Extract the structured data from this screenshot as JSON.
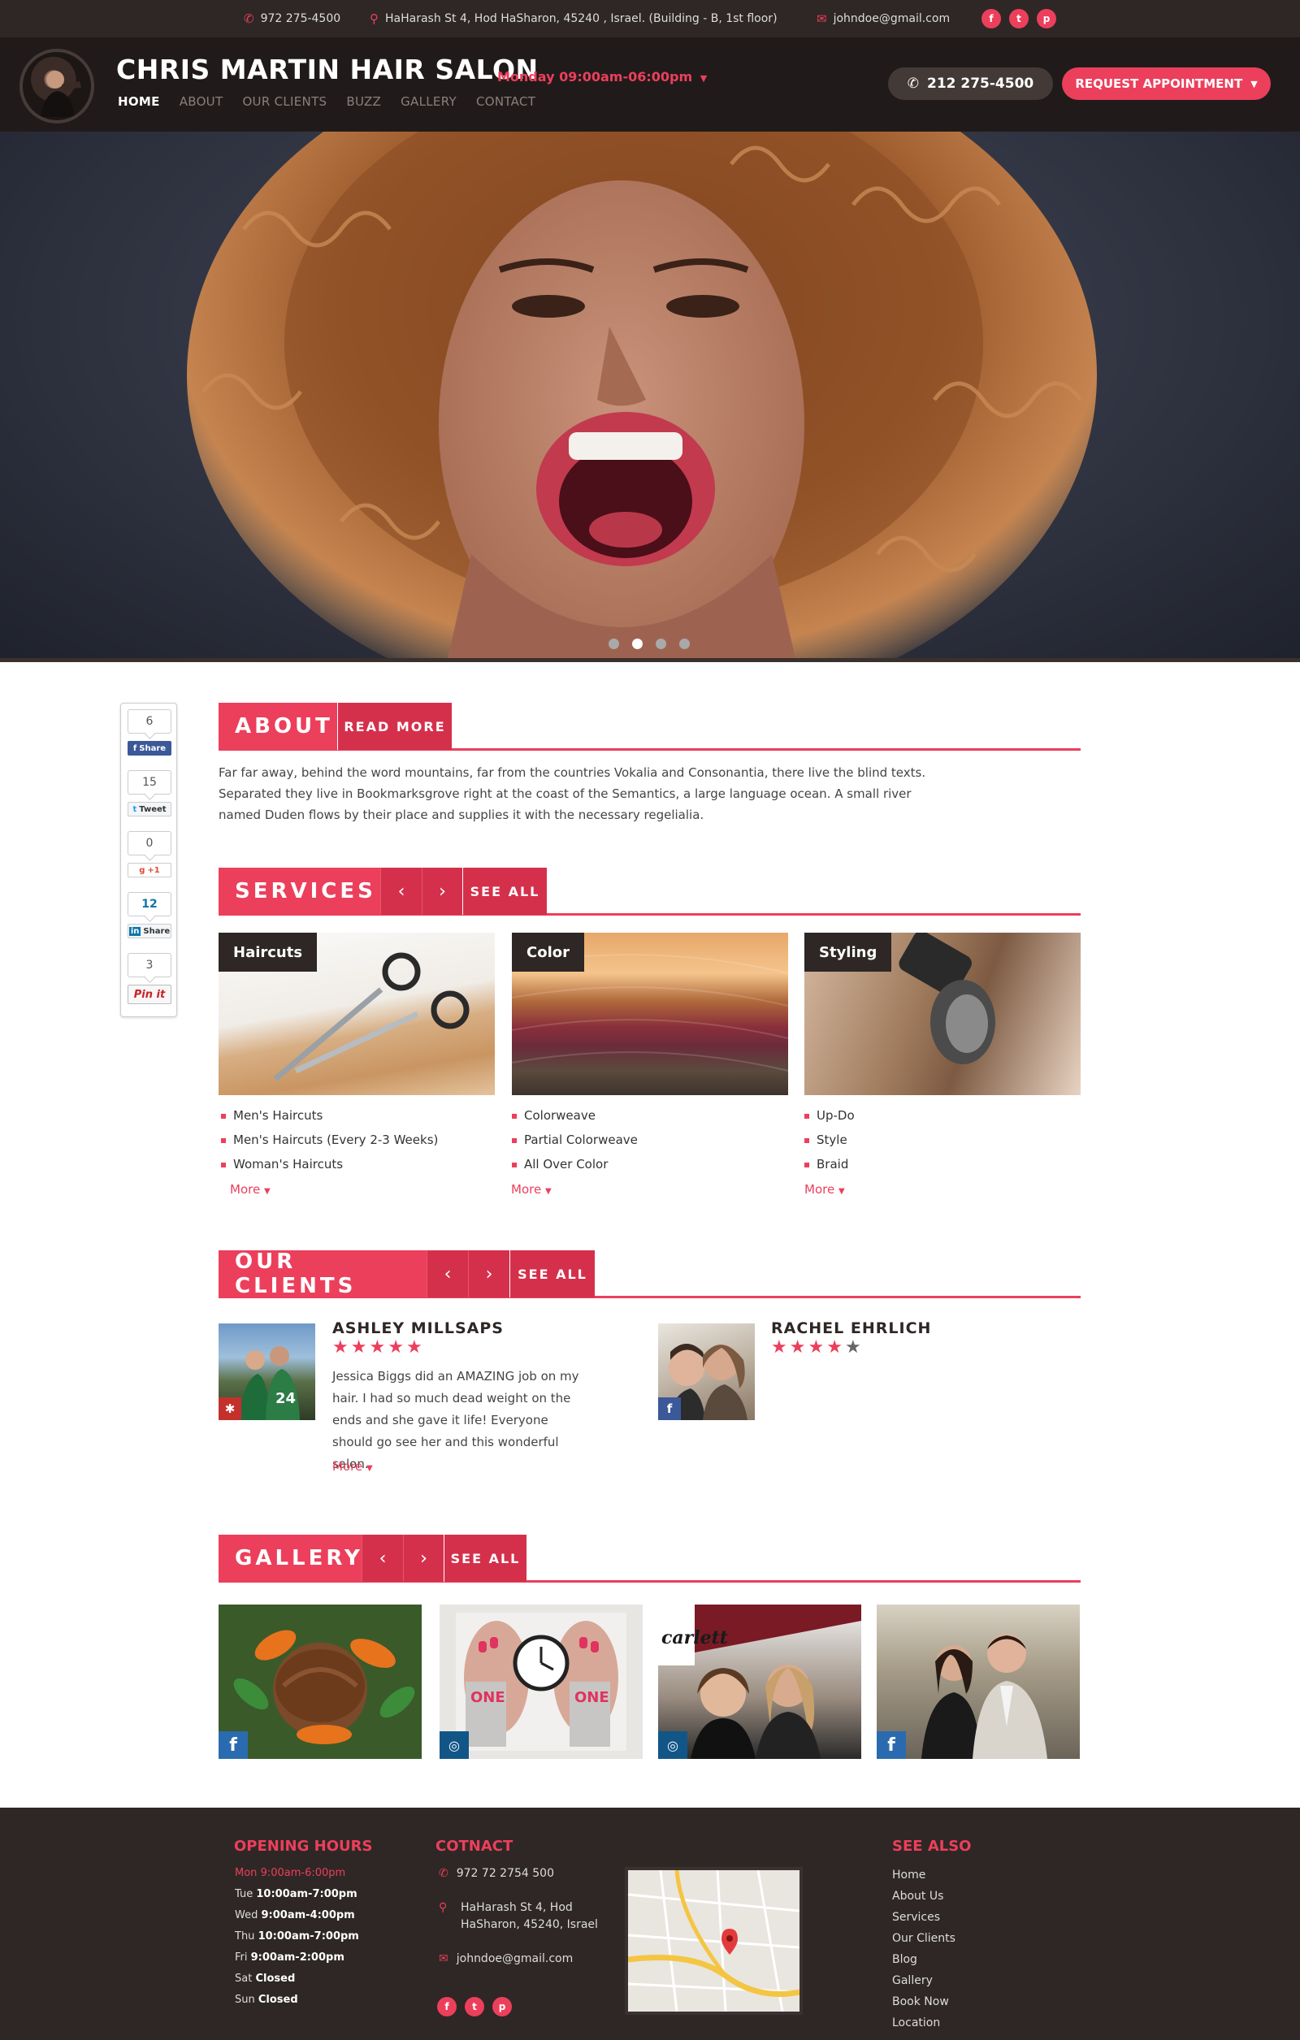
{
  "topbar": {
    "phone": "972 275-4500",
    "address": "HaHarash St 4, Hod HaSharon, 45240 , Israel. (Building - B, 1st floor)",
    "email": "johndoe@gmail.com",
    "social": [
      "facebook-icon",
      "twitter-icon",
      "pinterest-icon"
    ]
  },
  "header": {
    "title": "CHRIS MARTIN HAIR SALON",
    "hours": "Monday 09:00am-06:00pm",
    "nav": [
      "HOME",
      "ABOUT",
      "OUR CLIENTS",
      "BUZZ",
      "GALLERY",
      "CONTACT"
    ],
    "active_nav": "HOME",
    "phone_button": "212 275-4500",
    "appointment_button": "REQUEST APPOINTMENT"
  },
  "hero": {
    "slide_count": 4,
    "active_slide": 2
  },
  "share": {
    "facebook": {
      "count": "6",
      "label": "Share"
    },
    "twitter": {
      "count": "15",
      "label": "Tweet"
    },
    "google": {
      "count": "0",
      "label": "+1"
    },
    "linkedin": {
      "count": "12",
      "label": "Share"
    },
    "pinterest": {
      "count": "3",
      "label": "Pin it"
    }
  },
  "about": {
    "title": "ABOUT",
    "read_more": "READ MORE",
    "text": "Far far away, behind the word mountains, far from the countries Vokalia and Consonantia, there live the blind texts. Separated they live in Bookmarksgrove right at the coast of the Semantics, a large language ocean. A small river named Duden flows by their place and supplies it with the necessary regelialia."
  },
  "services": {
    "title": "SERVICES",
    "see_all": "SEE ALL",
    "items": [
      {
        "label": "Haircuts",
        "list": [
          "Men's Haircuts",
          "Men's Haircuts (Every 2-3 Weeks)",
          "Woman's Haircuts"
        ],
        "more": "More"
      },
      {
        "label": "Color",
        "list": [
          "Colorweave",
          "Partial Colorweave",
          "All Over Color"
        ],
        "more": "More"
      },
      {
        "label": "Styling",
        "list": [
          "Up-Do",
          "Style",
          "Braid"
        ],
        "more": "More"
      }
    ]
  },
  "clients": {
    "title": "OUR CLIENTS",
    "see_all": "SEE ALL",
    "items": [
      {
        "name": "ASHLEY MILLSAPS",
        "rating": 5,
        "text": "Jessica Biggs did an AMAZING job on my hair. I had so much dead weight on the ends and she gave it life! Everyone should go see her and this wonderful salon.",
        "more": "More",
        "source": "yelp-icon"
      },
      {
        "name": "RACHEL EHRLICH",
        "rating": 4,
        "source": "facebook-icon"
      }
    ]
  },
  "gallery": {
    "title": "GALLERY",
    "see_all": "SEE ALL",
    "items": [
      {
        "source": "facebook-icon"
      },
      {
        "source": "instagram-icon",
        "caption_one": "ONE",
        "caption_two": "ONE"
      },
      {
        "source": "instagram-icon",
        "caption": "carlett"
      },
      {
        "source": "facebook-icon"
      }
    ]
  },
  "footer": {
    "hours_title": "OPENING HOURS",
    "hours": [
      {
        "day": "Mon",
        "time": "9:00am-6:00pm"
      },
      {
        "day": "Tue",
        "time": "10:00am-7:00pm"
      },
      {
        "day": "Wed",
        "time": "9:00am-4:00pm"
      },
      {
        "day": "Thu",
        "time": "10:00am-7:00pm"
      },
      {
        "day": "Fri",
        "time": "9:00am-2:00pm"
      },
      {
        "day": "Sat",
        "time": "Closed"
      },
      {
        "day": "Sun",
        "time": "Closed"
      }
    ],
    "contact_title": "COTNACT",
    "phone": "972 72 2754 500",
    "address_line1": "HaHarash St 4, Hod",
    "address_line2": "HaSharon, 45240, Israel",
    "email": "johndoe@gmail.com",
    "see_also_title": "SEE ALSO",
    "links": [
      "Home",
      "About Us",
      "Services",
      "Our Clients",
      "Blog",
      "Gallery",
      "Book Now",
      "Location"
    ]
  },
  "colors": {
    "accent": "#ec3f5c",
    "dark": "#2e2725",
    "header": "#201b1a"
  }
}
